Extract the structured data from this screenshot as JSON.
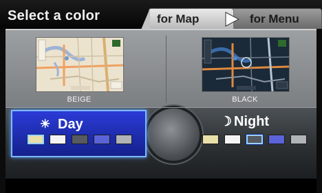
{
  "header": {
    "title": "Select a color",
    "tabs": [
      {
        "label": "for Map",
        "active": true
      },
      {
        "label": "for Menu",
        "active": false
      }
    ]
  },
  "previews": [
    {
      "name": "BEIGE"
    },
    {
      "name": "BLACK"
    }
  ],
  "day": {
    "label": "Day",
    "icon": "sun-icon",
    "swatches": [
      "#e8e0a8",
      "#f4f4f4",
      "#555b60",
      "#5b63d8",
      "#b0b4b8"
    ],
    "selected_index": 0,
    "active": true
  },
  "night": {
    "label": "Night",
    "icon": "moon-icon",
    "swatches": [
      "#e8e0a8",
      "#f4f4f4",
      "#555b60",
      "#5b63d8",
      "#b0b4b8"
    ],
    "selected_index": 2
  },
  "colors": {
    "accent": "#7fb8ff",
    "day_panel": "#2b3bd6",
    "panel_gray": "#8c8f92"
  }
}
